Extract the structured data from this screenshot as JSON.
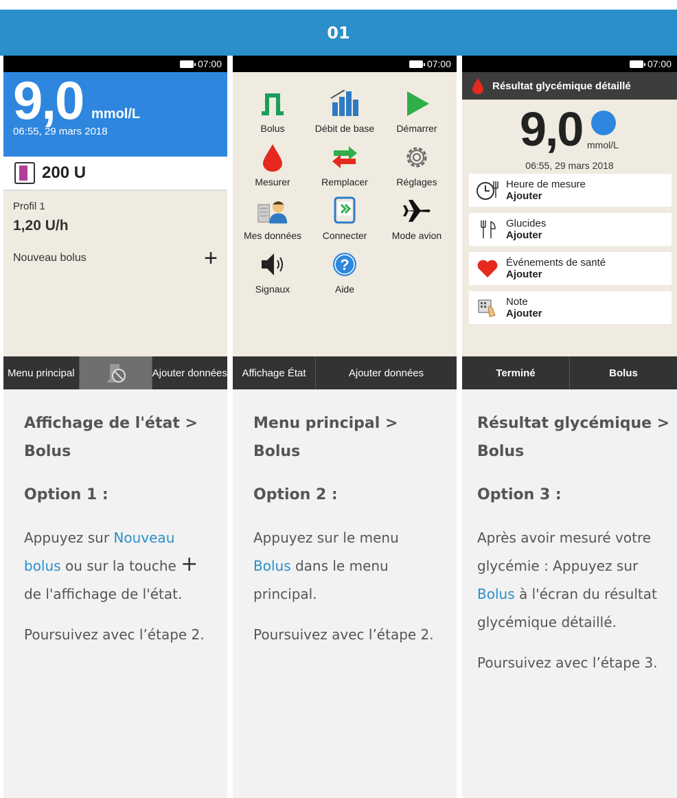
{
  "header": {
    "title": "01"
  },
  "screens": {
    "status_time": "07:00",
    "status": {
      "bg_value": "9,0",
      "bg_unit": "mmol/L",
      "bg_time": "06:55, 29 mars 2018",
      "insulin": "200 U",
      "profile": "Profil 1",
      "rate": "1,20 U/h",
      "new_bolus": "Nouveau bolus",
      "softkeys": [
        "Menu principal",
        "Ajouter données"
      ]
    },
    "menu": {
      "items": [
        {
          "label": "Bolus",
          "icon": "bolus-icon"
        },
        {
          "label": "Débit de base",
          "icon": "basal-rate-icon"
        },
        {
          "label": "Démarrer",
          "icon": "play-icon"
        },
        {
          "label": "Mesurer",
          "icon": "blood-drop-icon"
        },
        {
          "label": "Remplacer",
          "icon": "swap-arrows-icon"
        },
        {
          "label": "Réglages",
          "icon": "gear-icon"
        },
        {
          "label": "Mes données",
          "icon": "my-data-icon"
        },
        {
          "label": "Connecter",
          "icon": "connect-icon"
        },
        {
          "label": "Mode avion",
          "icon": "airplane-icon"
        },
        {
          "label": "Signaux",
          "icon": "speaker-icon"
        },
        {
          "label": "Aide",
          "icon": "help-icon"
        }
      ],
      "softkeys": [
        "Affichage État",
        "Ajouter données"
      ]
    },
    "result": {
      "title": "Résultat glycémique détaillé",
      "bg_value": "9,0",
      "bg_unit": "mmol/L",
      "bg_time": "06:55, 29 mars 2018",
      "cards": [
        {
          "label": "Heure de mesure",
          "action": "Ajouter",
          "icon": "clock-meal-icon"
        },
        {
          "label": "Glucides",
          "action": "Ajouter",
          "icon": "cutlery-icon"
        },
        {
          "label": "Événements de santé",
          "action": "Ajouter",
          "icon": "heart-icon"
        },
        {
          "label": "Note",
          "action": "Ajouter",
          "icon": "note-icon"
        }
      ],
      "softkeys": [
        "Terminé",
        "Bolus"
      ]
    }
  },
  "descriptions": [
    {
      "title": "Affichage de l'état > Bolus",
      "option": "Option 1 :",
      "p1_a": "Appuyez sur ",
      "p1_link": "Nouveau bolus",
      "p1_b": " ou sur la touche ",
      "p1_c": " de l'affichage de l'état.",
      "p2": "Poursuivez avec l’étape 2."
    },
    {
      "title": "Menu principal > Bolus",
      "option": "Option 2 :",
      "p1_a": "Appuyez sur le menu ",
      "p1_link": "Bolus",
      "p1_b": " dans le menu principal.",
      "p2": "Poursuivez avec l’étape 2."
    },
    {
      "title": "Résultat glycémique > Bolus",
      "option": "Option 3 :",
      "p1_a": "Après avoir mesuré votre glycémie : Appuyez sur ",
      "p1_link": "Bolus",
      "p1_b": " à l'écran du résultat glycémique détaillé.",
      "p2": "Poursuivez avec l’étape 3."
    }
  ]
}
